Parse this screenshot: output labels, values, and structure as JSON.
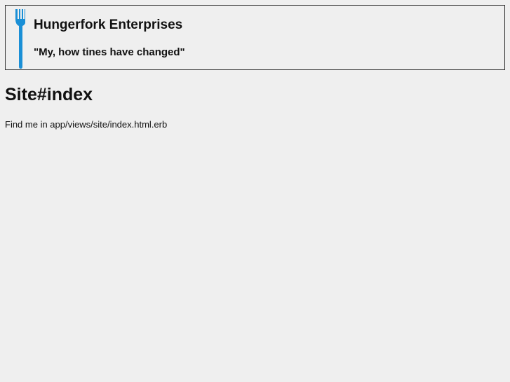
{
  "header": {
    "logo_icon": "fork-icon",
    "logo_color": "#1a8fd6",
    "company_name": "Hungerfork Enterprises",
    "tagline": "\"My, how tines have changed\""
  },
  "main": {
    "heading": "Site#index",
    "body_text": "Find me in app/views/site/index.html.erb"
  }
}
